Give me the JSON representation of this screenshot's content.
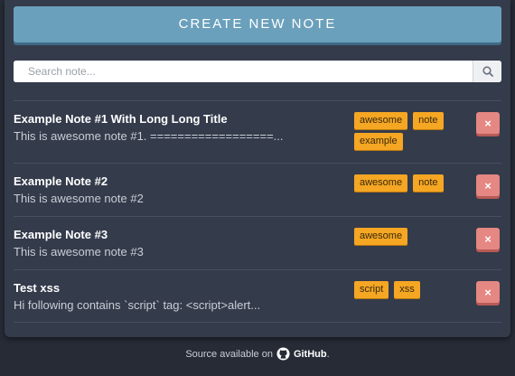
{
  "header": {
    "create_label": "CREATE NEW NOTE"
  },
  "search": {
    "placeholder": "Search note...",
    "icon": "search-icon"
  },
  "notes": [
    {
      "title": "Example Note #1 With Long Long Title",
      "desc": "This is awesome note #1. ==================...",
      "tags": [
        "awesome",
        "note",
        "example"
      ]
    },
    {
      "title": "Example Note #2",
      "desc": "This is awesome note #2",
      "tags": [
        "awesome",
        "note"
      ]
    },
    {
      "title": "Example Note #3",
      "desc": "This is awesome note #3",
      "tags": [
        "awesome"
      ]
    },
    {
      "title": "Test xss",
      "desc": "Hi following contains `script` tag: <script>alert...",
      "tags": [
        "script",
        "xss"
      ]
    }
  ],
  "delete_label": "×",
  "footer": {
    "prefix": "Source available on",
    "link": "GitHub",
    "suffix": ".",
    "icon": "github-icon"
  },
  "colors": {
    "background": "#262b36",
    "panel": "#343b4b",
    "button": "#6ba0bc",
    "tag": "#f5a623",
    "delete": "#e58782"
  }
}
